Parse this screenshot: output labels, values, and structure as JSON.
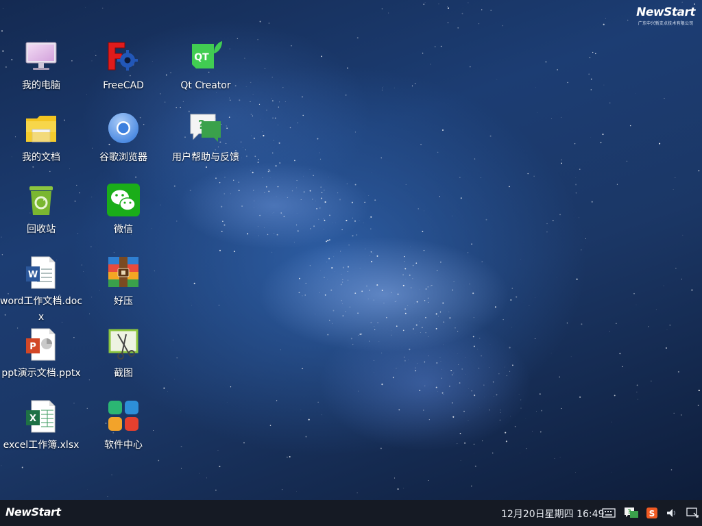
{
  "brand": {
    "name": "NewStart",
    "company": "广东中兴新支点技术有限公司"
  },
  "desktop": {
    "icons": [
      {
        "label": "我的电脑",
        "icon": "computer-icon"
      },
      {
        "label": "FreeCAD",
        "icon": "freecad-icon"
      },
      {
        "label": "Qt Creator",
        "icon": "qt-creator-icon"
      },
      {
        "label": "我的文档",
        "icon": "folder-icon"
      },
      {
        "label": "谷歌浏览器",
        "icon": "chrome-icon"
      },
      {
        "label": "用户帮助与反馈",
        "icon": "help-feedback-icon"
      },
      {
        "label": "回收站",
        "icon": "recycle-bin-icon"
      },
      {
        "label": "微信",
        "icon": "wechat-icon"
      },
      {
        "label": "word工作文档.docx",
        "icon": "word-document-icon"
      },
      {
        "label": "好压",
        "icon": "archive-icon"
      },
      {
        "label": "ppt演示文档.pptx",
        "icon": "powerpoint-document-icon"
      },
      {
        "label": "截图",
        "icon": "screenshot-icon"
      },
      {
        "label": "excel工作簿.xlsx",
        "icon": "excel-workbook-icon"
      },
      {
        "label": "软件中心",
        "icon": "software-center-icon"
      }
    ]
  },
  "taskbar": {
    "start_label": "NewStart",
    "clock": "12月20日星期四 16:49",
    "tray": [
      {
        "icon": "keyboard-icon"
      },
      {
        "icon": "help-icon"
      },
      {
        "icon": "sogou-input-icon"
      },
      {
        "icon": "volume-icon"
      },
      {
        "icon": "show-desktop-icon"
      }
    ]
  },
  "colors": {
    "taskbar": "#151a24",
    "desktop_accent": "#2d5da3"
  }
}
